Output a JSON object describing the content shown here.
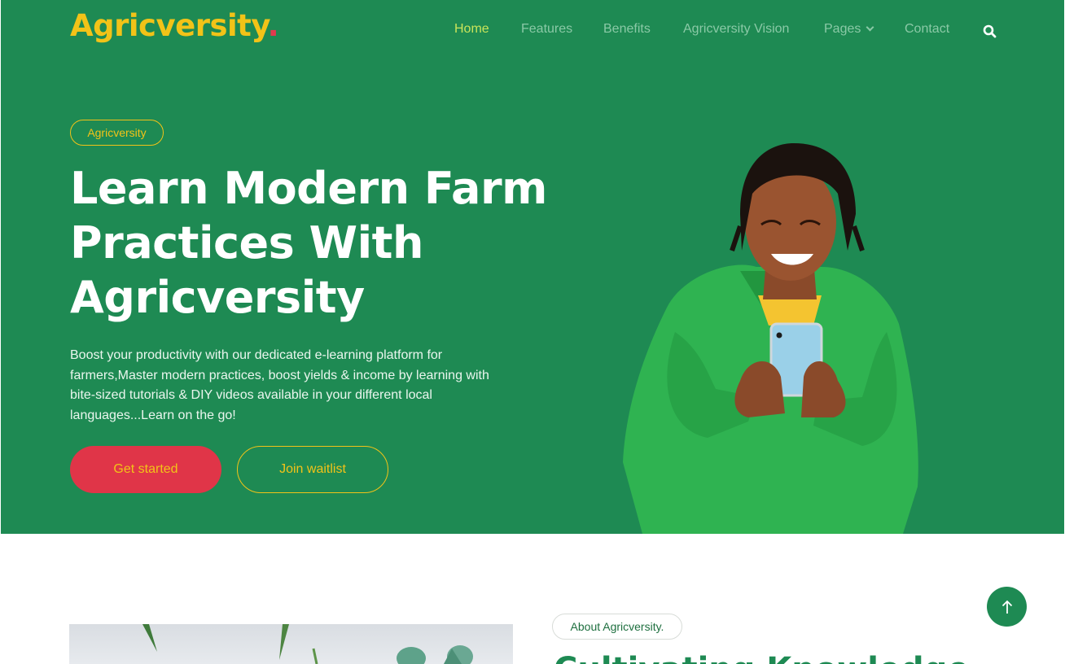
{
  "brand": {
    "name": "Agricversity",
    "dot": "."
  },
  "nav": {
    "items": [
      {
        "label": "Home",
        "active": true
      },
      {
        "label": "Features"
      },
      {
        "label": "Benefits"
      },
      {
        "label": "Agricversity Vision"
      },
      {
        "label": "Pages",
        "has_dropdown": true
      },
      {
        "label": "Contact"
      }
    ],
    "search_icon": "search-icon"
  },
  "hero": {
    "tag": "Agricversity",
    "headline_lines": [
      "Learn Modern Farm",
      "Practices With",
      "Agricversity"
    ],
    "description": "Boost your productivity with our dedicated e-learning platform for farmers,Master modern practices, boost yields & income by learning with bite-sized tutorials & DIY videos available in your different local languages...Learn on the go!",
    "primary_button": "Get started",
    "secondary_button": "Join waitlist"
  },
  "about": {
    "tag": "About Agricversity.",
    "heading": "Cultivating Knowledge"
  },
  "scroll_top_icon": "arrow-up-icon",
  "colors": {
    "primary_green": "#1e8a53",
    "accent_yellow": "#f2c318",
    "accent_red": "#e03548",
    "nav_active": "#c9e45a"
  }
}
